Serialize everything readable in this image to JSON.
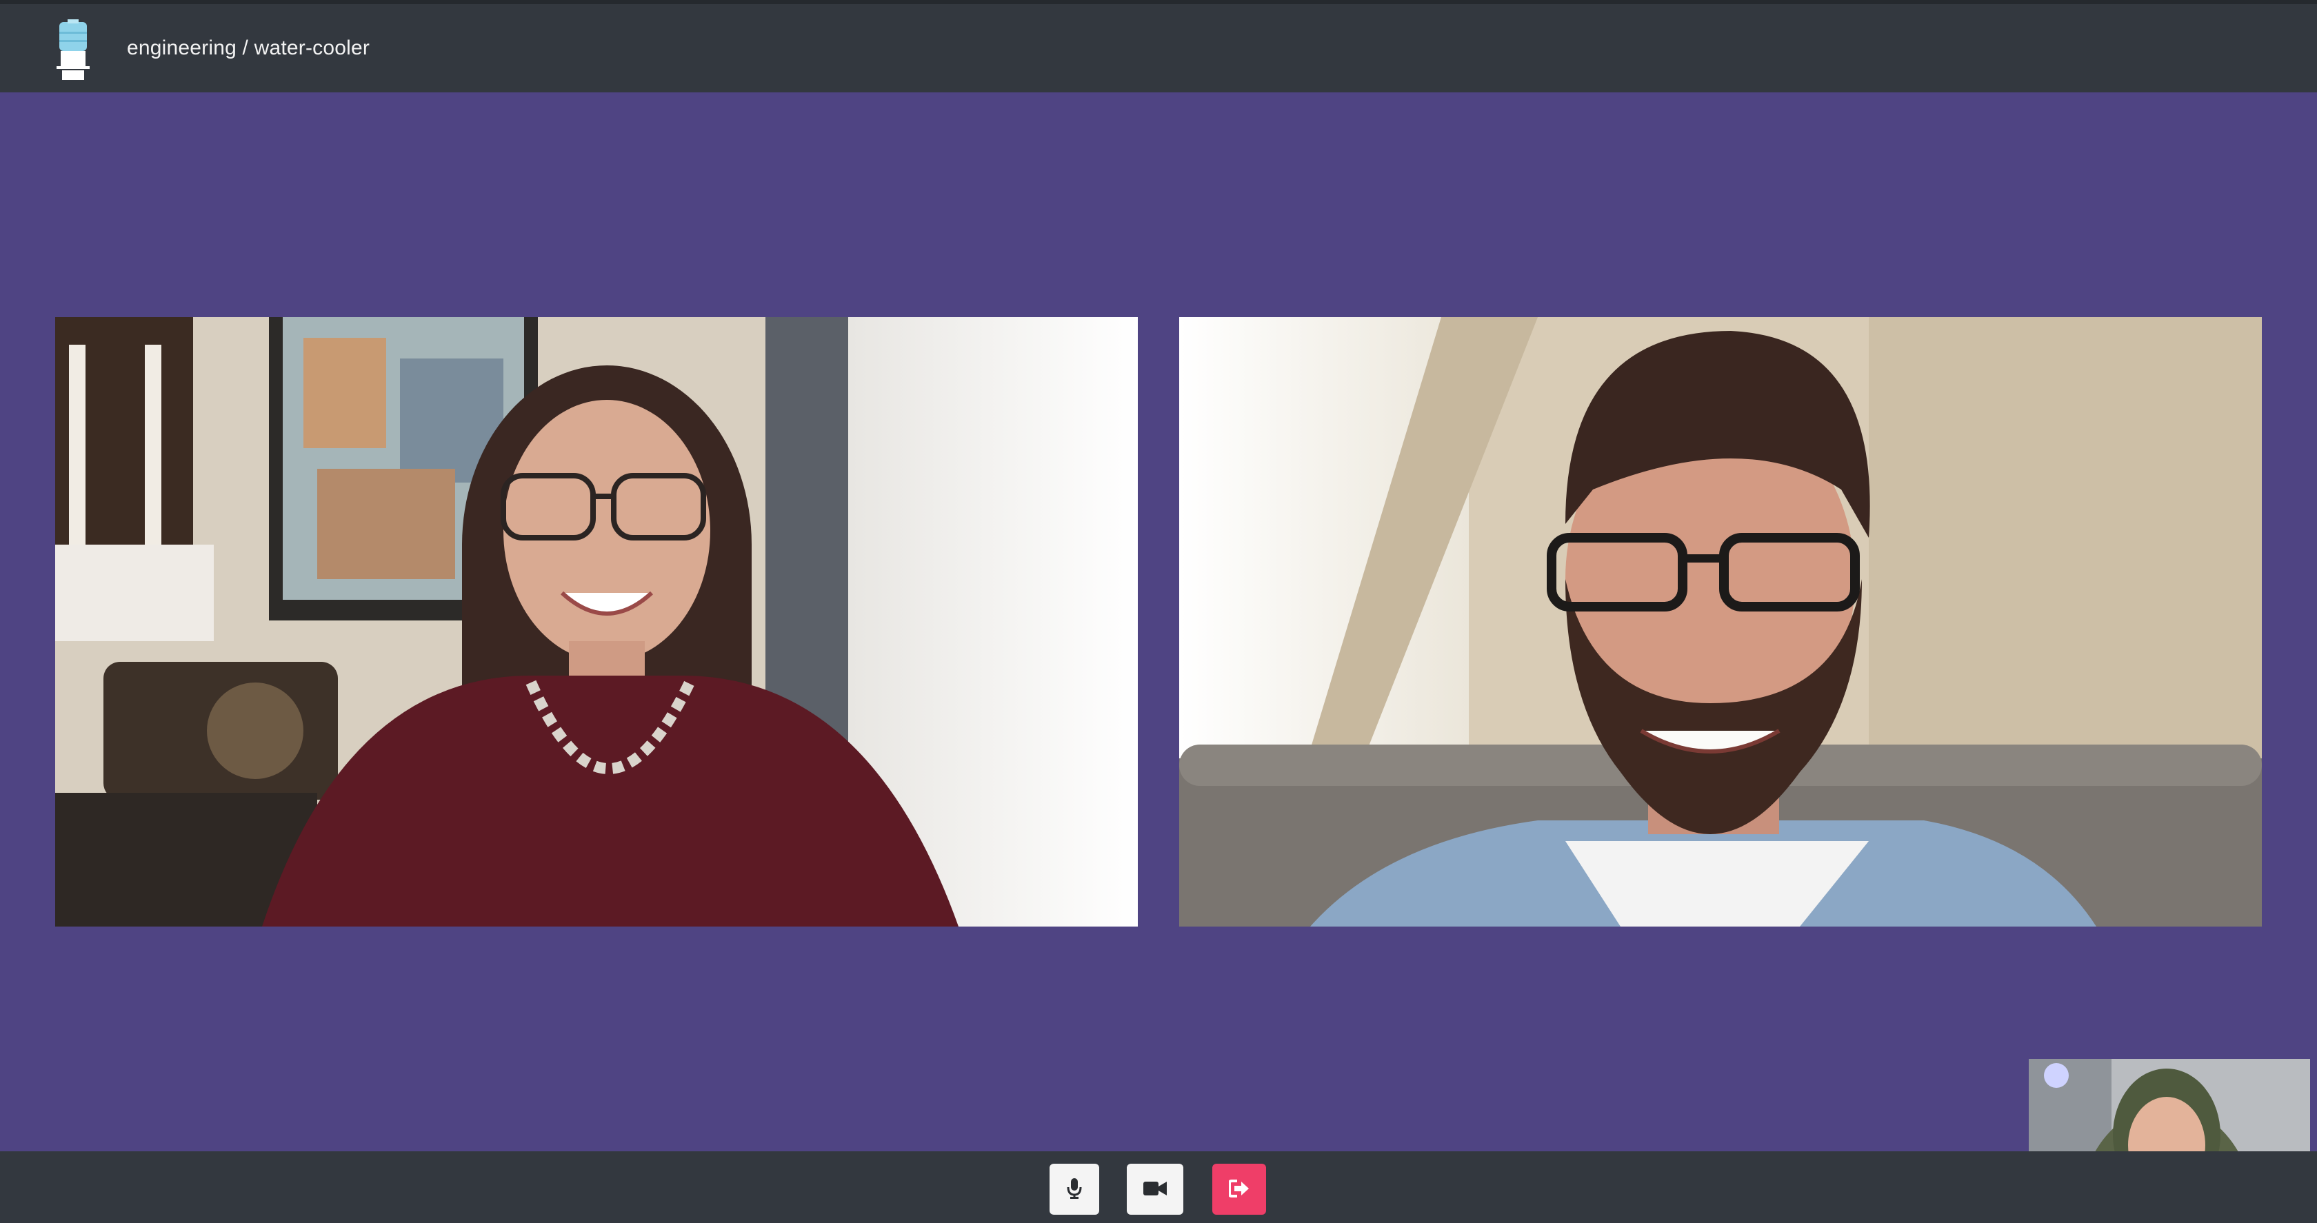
{
  "header": {
    "logo_icon": "water-cooler-icon",
    "title": "engineering / water-cooler"
  },
  "colors": {
    "topbar": "#33383f",
    "stage": "#4f4483",
    "leave_button": "#ef3e68",
    "control_button": "#f4f4f4"
  },
  "participants": [
    {
      "id": "participant-1",
      "video": "remote-video"
    },
    {
      "id": "participant-2",
      "video": "remote-video"
    }
  ],
  "self_view": {
    "video": "local-video"
  },
  "controls": {
    "mic_icon": "microphone-icon",
    "camera_icon": "video-camera-icon",
    "leave_icon": "leave-icon"
  }
}
